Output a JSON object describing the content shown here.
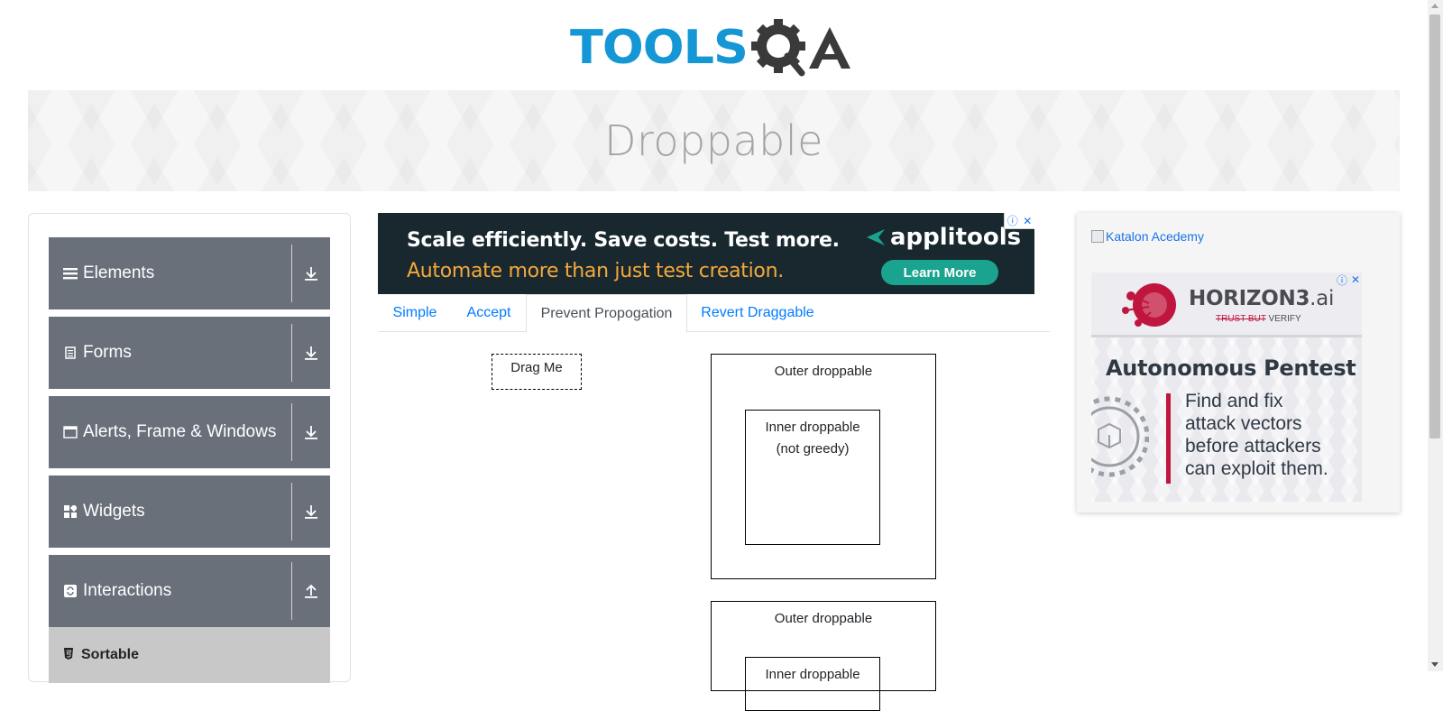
{
  "logo": {
    "text": "TOOLS",
    "suffix": "QA",
    "color_primary": "#1497d4",
    "color_secondary": "#3a3a3a"
  },
  "banner": {
    "title": "Droppable"
  },
  "sidebar": {
    "groups": [
      {
        "label": "Elements",
        "icon": "list-icon",
        "toggle": "download-icon"
      },
      {
        "label": "Forms",
        "icon": "document-icon",
        "toggle": "download-icon"
      },
      {
        "label": "Alerts, Frame & Windows",
        "icon": "window-icon",
        "toggle": "download-icon"
      },
      {
        "label": "Widgets",
        "icon": "widgets-icon",
        "toggle": "download-icon"
      },
      {
        "label": "Interactions",
        "icon": "interactions-icon",
        "toggle": "upload-icon"
      }
    ],
    "sub_items": [
      {
        "label": "Sortable",
        "icon": "html5-icon"
      }
    ]
  },
  "ad_banner": {
    "line1": "Scale efficiently. Save costs. Test more.",
    "line2": "Automate more than just test creation.",
    "brand": "applitools",
    "cta": "Learn More"
  },
  "tabs": [
    {
      "label": "Simple",
      "active": false
    },
    {
      "label": "Accept",
      "active": false
    },
    {
      "label": "Prevent Propogation",
      "active": true
    },
    {
      "label": "Revert Draggable",
      "active": false
    }
  ],
  "drag": {
    "drag_label": "Drag Me",
    "outer_label": "Outer droppable",
    "inner_label_line1": "Inner droppable",
    "inner_label_line2": "(not greedy)",
    "inner_label_2": "Inner droppable"
  },
  "side_ad": {
    "broken_image_alt": "Katalon Acedemy",
    "brand": "HORIZON3",
    "brand_suffix": ".ai",
    "tagline_struck": "TRUST BUT",
    "tagline": "VERIFY",
    "headline": "Autonomous Pentest",
    "body_lines": [
      "Find and fix",
      "attack vectors",
      "before attackers",
      "can exploit them."
    ]
  }
}
